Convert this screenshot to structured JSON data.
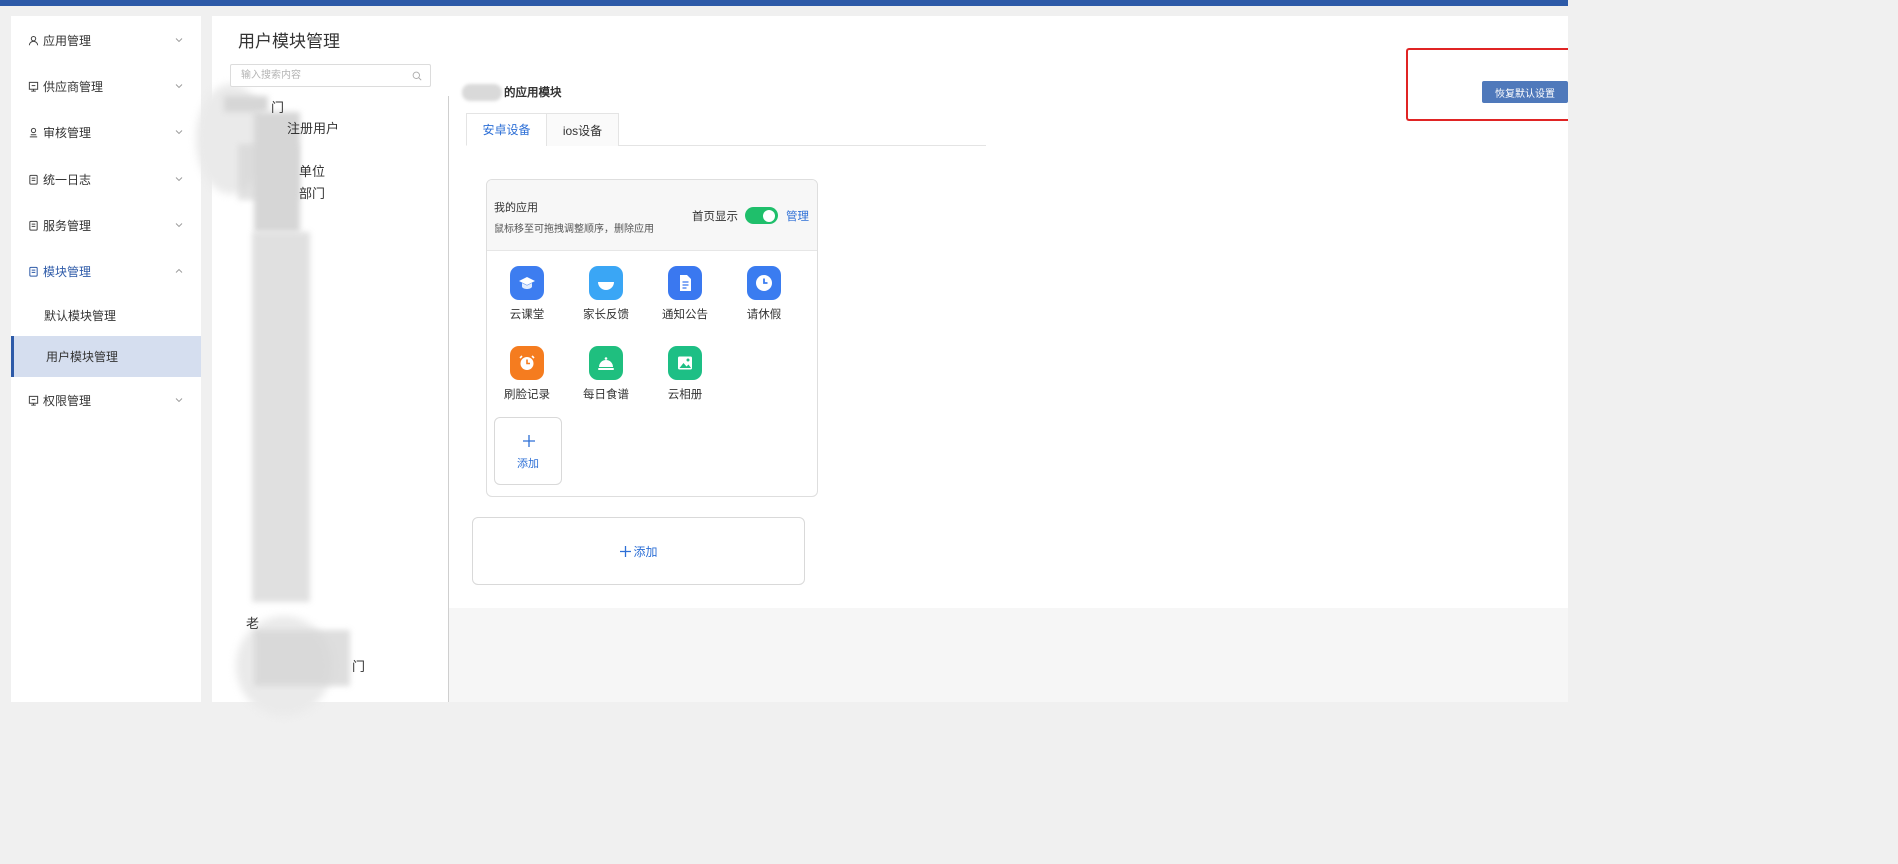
{
  "sidebar": {
    "items": [
      {
        "label": "应用管理",
        "icon": "user-icon",
        "expanded": false
      },
      {
        "label": "供应商管理",
        "icon": "supplier-icon",
        "expanded": false
      },
      {
        "label": "审核管理",
        "icon": "audit-icon",
        "expanded": false
      },
      {
        "label": "统一日志",
        "icon": "log-icon",
        "expanded": false
      },
      {
        "label": "服务管理",
        "icon": "service-icon",
        "expanded": false
      },
      {
        "label": "模块管理",
        "icon": "module-icon",
        "expanded": true
      },
      {
        "label": "权限管理",
        "icon": "permission-icon",
        "expanded": false
      }
    ],
    "subitems": [
      {
        "label": "默认模块管理",
        "selected": false
      },
      {
        "label": "用户模块管理",
        "selected": true
      }
    ]
  },
  "page": {
    "title": "用户模块管理"
  },
  "tree": {
    "search_placeholder": "输入搜索内容",
    "nodes": [
      "门",
      "注册用户",
      "单位",
      "部门",
      "老",
      "门"
    ]
  },
  "module": {
    "title_suffix": "的应用模块",
    "tabs": [
      {
        "label": "安卓设备",
        "active": true
      },
      {
        "label": "ios设备",
        "active": false
      }
    ],
    "card": {
      "title": "我的应用",
      "tip": "鼠标移至可拖拽调整顺序，删除应用",
      "home_label": "首页显示",
      "home_toggle_on": true,
      "manage_label": "管理",
      "apps": [
        {
          "label": "云课堂",
          "icon": "cloud-class-icon",
          "color": "#3d7df0"
        },
        {
          "label": "家长反馈",
          "icon": "feedback-icon",
          "color": "#3aa6f5"
        },
        {
          "label": "通知公告",
          "icon": "notice-icon",
          "color": "#3a78f0"
        },
        {
          "label": "请休假",
          "icon": "clock-icon",
          "color": "#3a7cf0"
        },
        {
          "label": "刷脸记录",
          "icon": "face-record-icon",
          "color": "#f57c1f"
        },
        {
          "label": "每日食谱",
          "icon": "recipe-icon",
          "color": "#1fbf7f"
        },
        {
          "label": "云相册",
          "icon": "album-icon",
          "color": "#1dbf85"
        }
      ],
      "add_tile_label": "添加"
    },
    "add_block_label": "添加"
  },
  "restore_button": {
    "label": "恢复默认设置"
  },
  "colors": {
    "brand": "#2d5aa8",
    "accent": "#2d6fd6",
    "toggle_on": "#1fbf6b",
    "highlight": "#e02424"
  }
}
